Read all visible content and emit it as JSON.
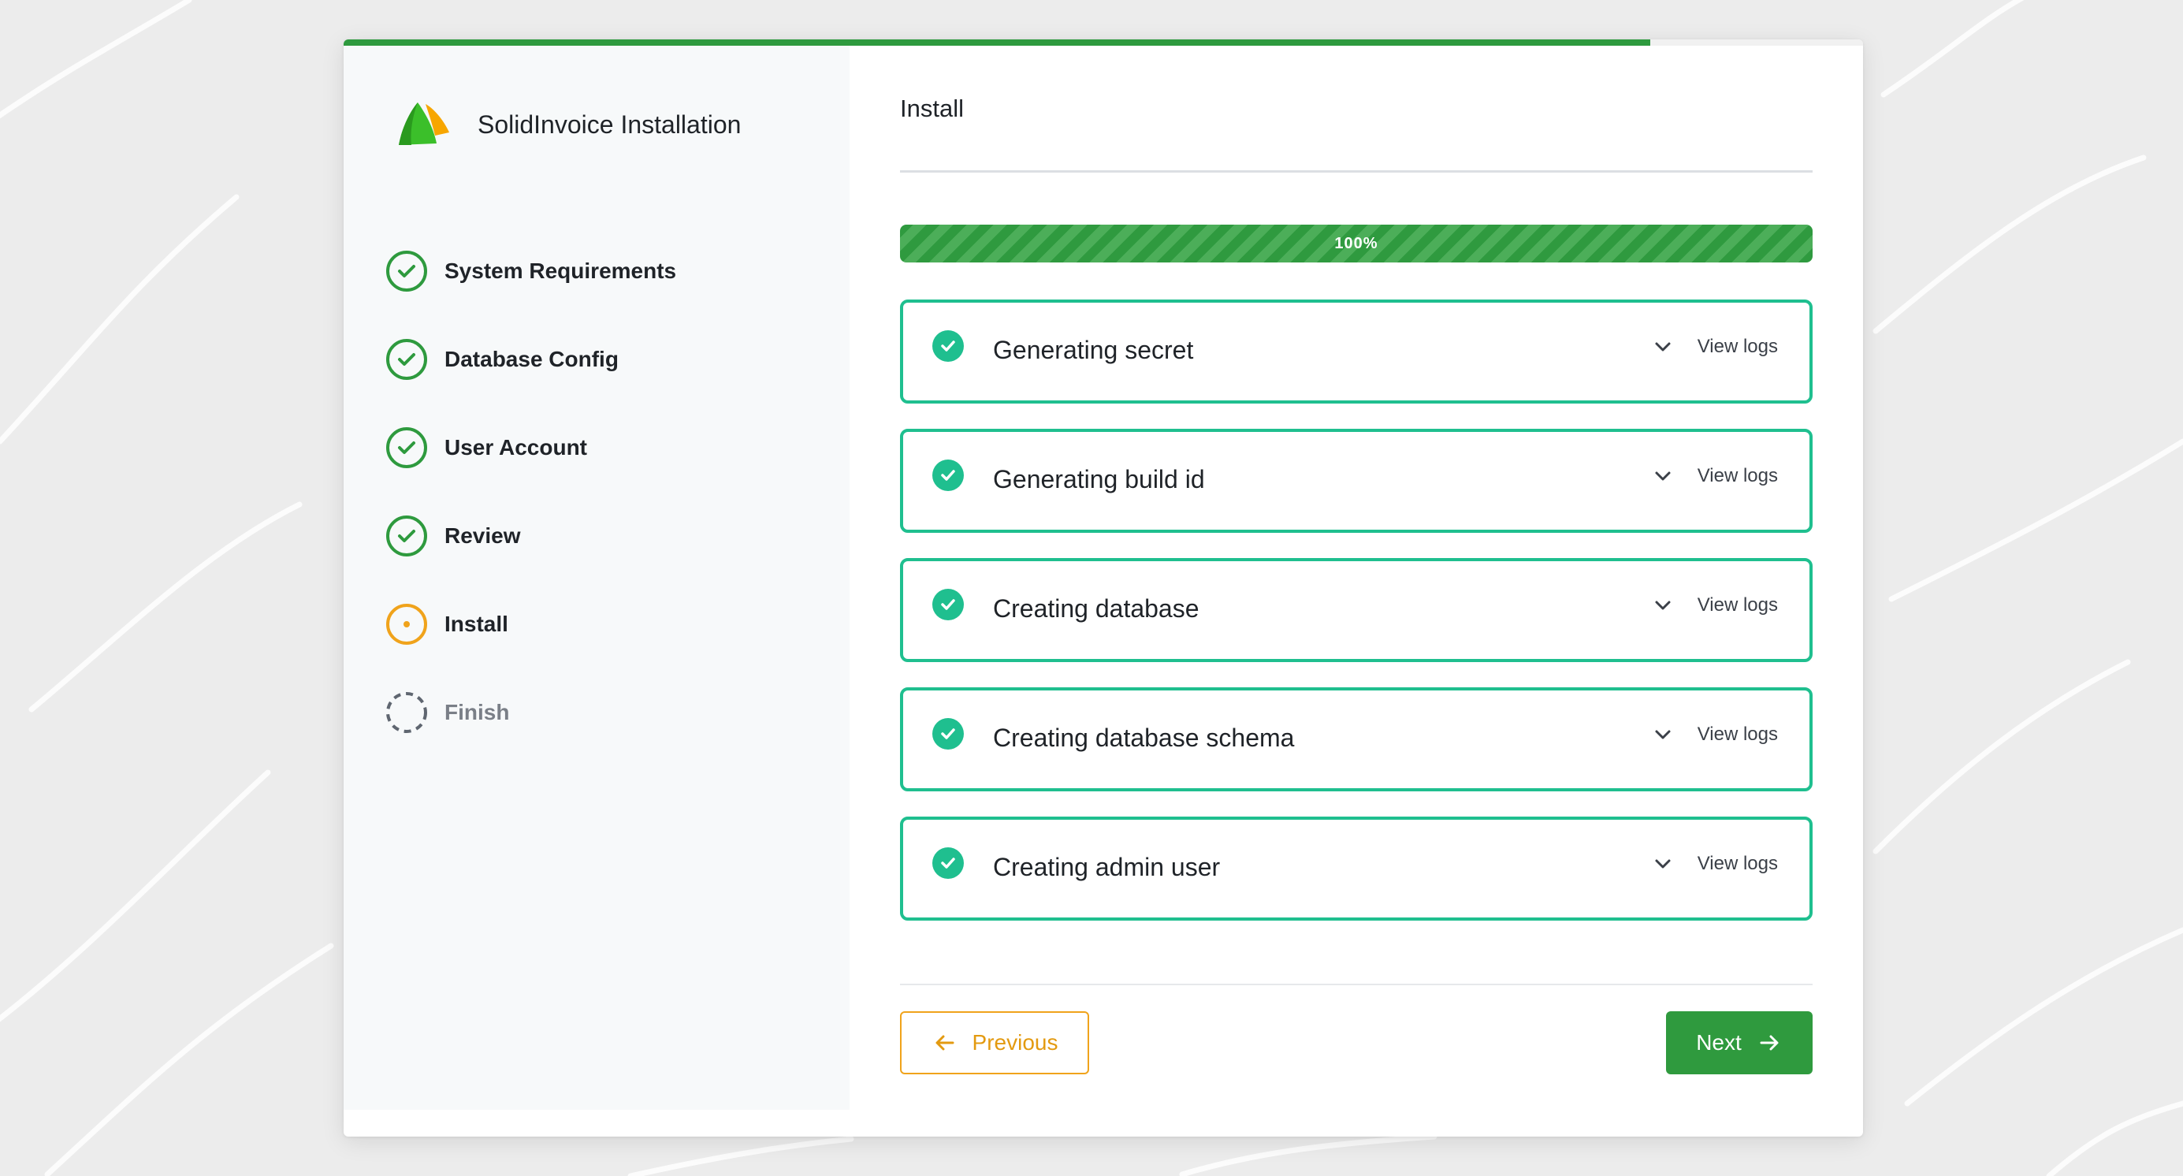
{
  "app": {
    "title": "SolidInvoice Installation",
    "top_progress_percent": 86
  },
  "colors": {
    "success": "#2e9a3e",
    "task_border": "#1fbf8f",
    "current_step": "#f0a31b",
    "pending_step": "#5f6670"
  },
  "sidebar": {
    "steps": [
      {
        "label": "System Requirements",
        "state": "complete",
        "icon": "check-circle-icon"
      },
      {
        "label": "Database Config",
        "state": "complete",
        "icon": "check-circle-icon"
      },
      {
        "label": "User Account",
        "state": "complete",
        "icon": "check-circle-icon"
      },
      {
        "label": "Review",
        "state": "complete",
        "icon": "check-circle-icon"
      },
      {
        "label": "Install",
        "state": "current",
        "icon": "current-step-icon"
      },
      {
        "label": "Finish",
        "state": "pending",
        "icon": "dashed-circle-icon"
      }
    ]
  },
  "main": {
    "title": "Install",
    "progress": {
      "percent": 100,
      "label": "100%"
    },
    "tasks": [
      {
        "label": "Generating secret",
        "status": "done",
        "toggle_label": "View logs"
      },
      {
        "label": "Generating build id",
        "status": "done",
        "toggle_label": "View logs"
      },
      {
        "label": "Creating database",
        "status": "done",
        "toggle_label": "View logs"
      },
      {
        "label": "Creating database schema",
        "status": "done",
        "toggle_label": "View logs"
      },
      {
        "label": "Creating admin user",
        "status": "done",
        "toggle_label": "View logs"
      }
    ]
  },
  "footer": {
    "previous_label": "Previous",
    "next_label": "Next"
  }
}
